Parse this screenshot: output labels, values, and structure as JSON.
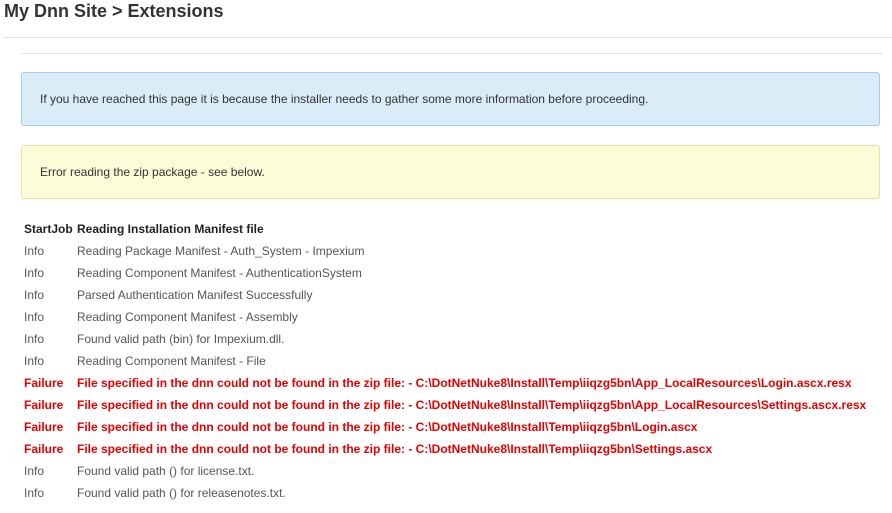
{
  "header": {
    "title": "My Dnn Site > Extensions"
  },
  "alerts": {
    "info": "If you have reached this page it is because the installer needs to gather some more information before proceeding.",
    "warning": "Error reading the zip package - see below."
  },
  "log": [
    {
      "type": "StartJob",
      "message": "Reading Installation Manifest file",
      "kind": "header"
    },
    {
      "type": "Info",
      "message": "Reading Package Manifest - Auth_System - Impexium",
      "kind": "info"
    },
    {
      "type": "Info",
      "message": "Reading Component Manifest - AuthenticationSystem",
      "kind": "info"
    },
    {
      "type": "Info",
      "message": "Parsed Authentication Manifest Successfully",
      "kind": "info"
    },
    {
      "type": "Info",
      "message": "Reading Component Manifest - Assembly",
      "kind": "info"
    },
    {
      "type": "Info",
      "message": "Found valid path (bin) for Impexium.dll.",
      "kind": "info"
    },
    {
      "type": "Info",
      "message": "Reading Component Manifest - File",
      "kind": "info"
    },
    {
      "type": "Failure",
      "message": "File specified in the dnn could not be found in the zip file: - C:\\DotNetNuke8\\Install\\Temp\\iiqzg5bn\\App_LocalResources\\Login.ascx.resx",
      "kind": "failure"
    },
    {
      "type": "Failure",
      "message": "File specified in the dnn could not be found in the zip file: - C:\\DotNetNuke8\\Install\\Temp\\iiqzg5bn\\App_LocalResources\\Settings.ascx.resx",
      "kind": "failure"
    },
    {
      "type": "Failure",
      "message": "File specified in the dnn could not be found in the zip file: - C:\\DotNetNuke8\\Install\\Temp\\iiqzg5bn\\Login.ascx",
      "kind": "failure"
    },
    {
      "type": "Failure",
      "message": "File specified in the dnn could not be found in the zip file: - C:\\DotNetNuke8\\Install\\Temp\\iiqzg5bn\\Settings.ascx",
      "kind": "failure"
    },
    {
      "type": "Info",
      "message": "Found valid path () for license.txt.",
      "kind": "info"
    },
    {
      "type": "Info",
      "message": "Found valid path () for releasenotes.txt.",
      "kind": "info"
    }
  ],
  "colors": {
    "failure": "#e60000",
    "info_alert_bg": "#d9ecf8",
    "warning_alert_bg": "#fcfcd9"
  }
}
